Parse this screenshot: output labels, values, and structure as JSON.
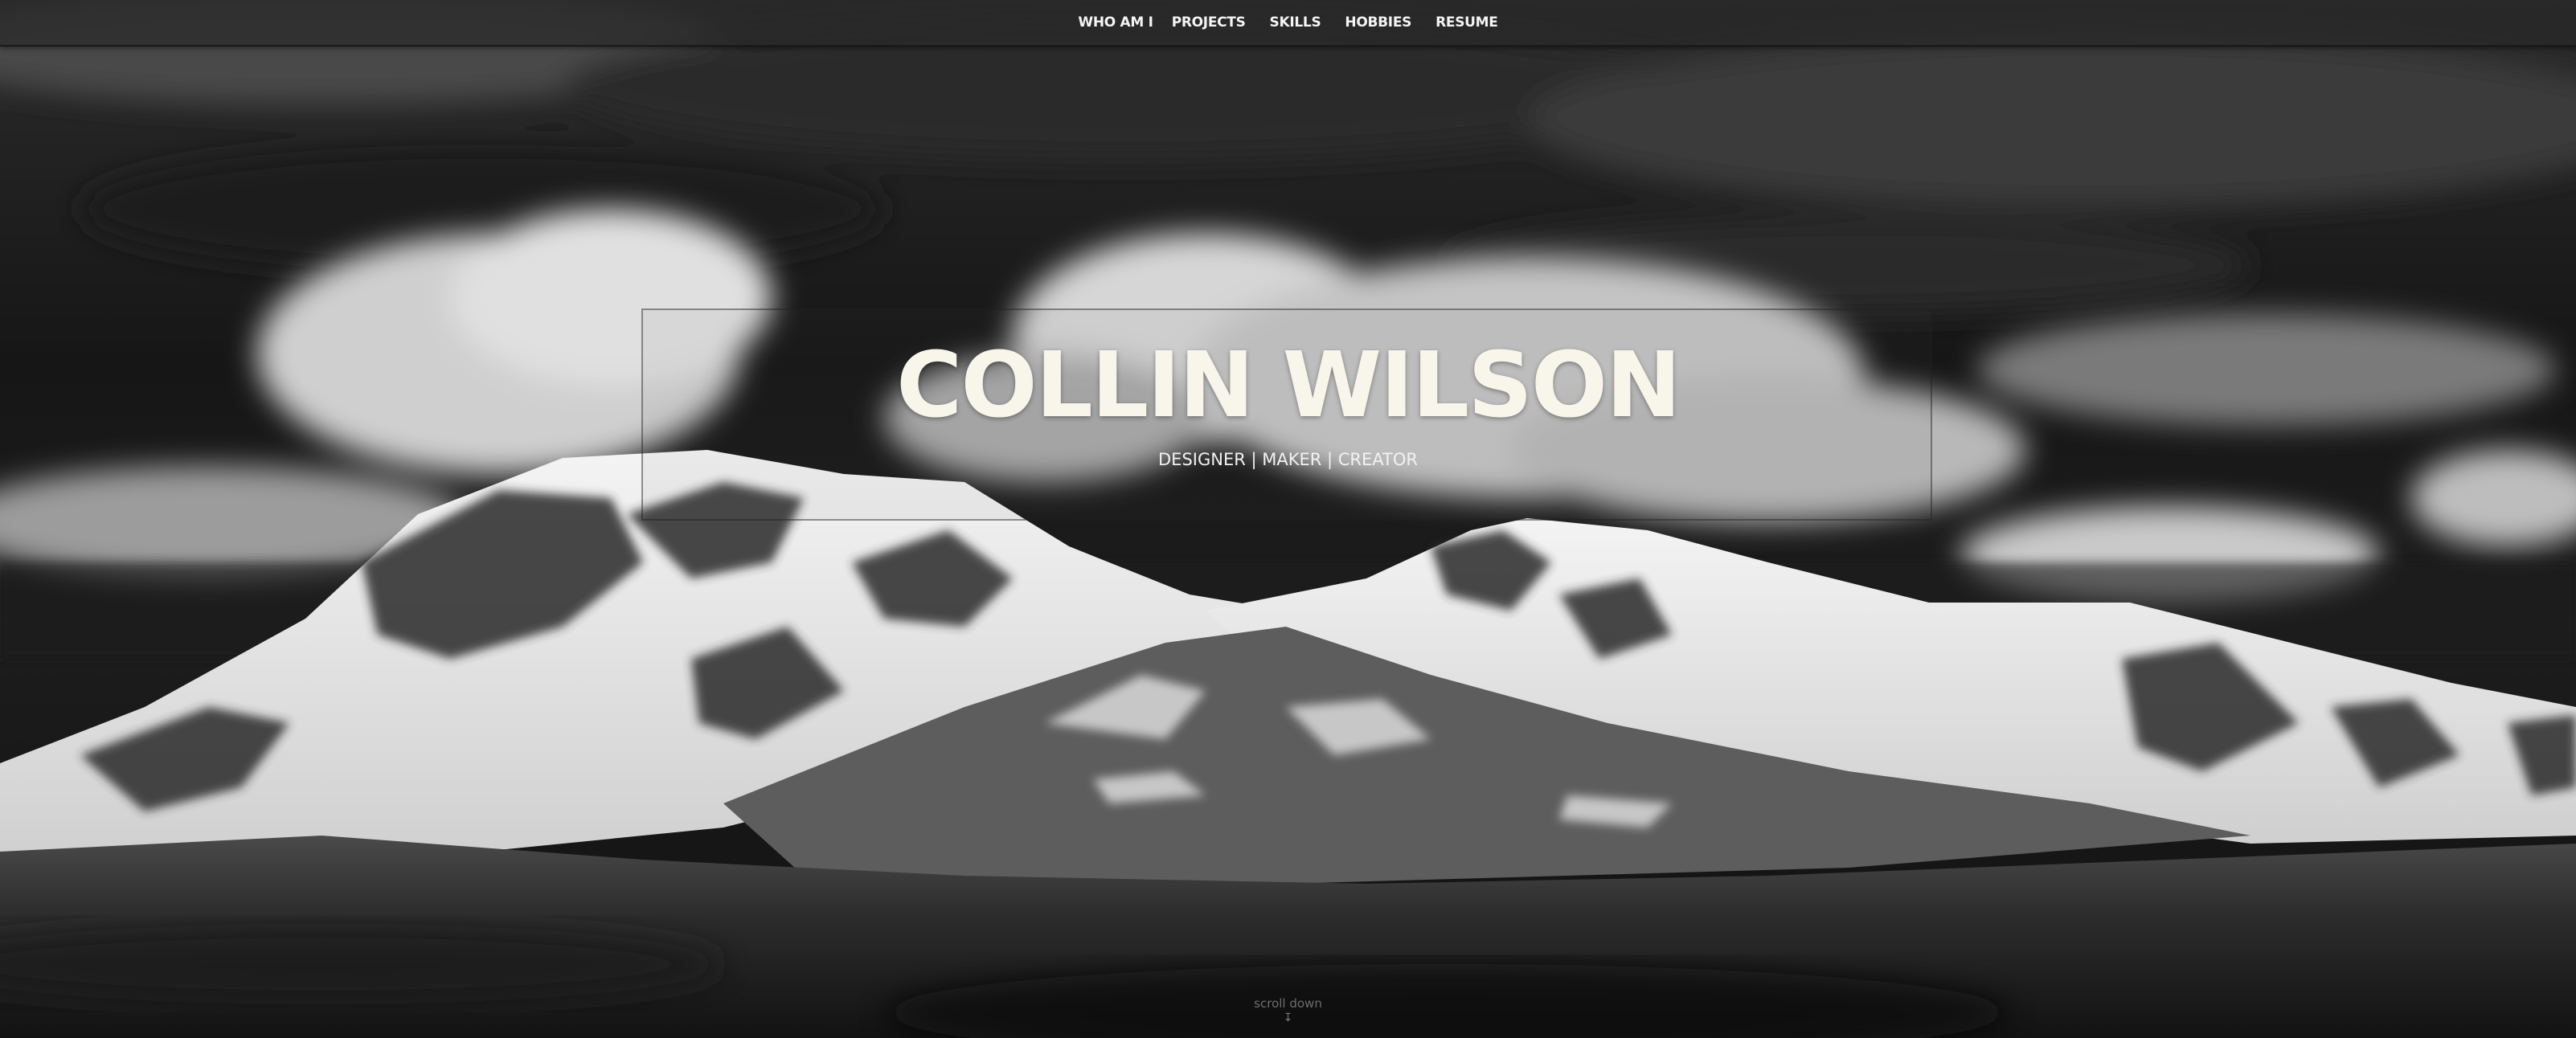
{
  "nav": {
    "items": [
      {
        "label": "WHO AM I"
      },
      {
        "label": "PROJECTS"
      },
      {
        "label": "SKILLS"
      },
      {
        "label": "HOBBIES"
      },
      {
        "label": "RESUME"
      }
    ]
  },
  "hero": {
    "name": "COLLIN WILSON",
    "tagline": "DESIGNER | MAKER | CREATOR",
    "background": "black-and-white-snowy-mountain-photo"
  },
  "scroll": {
    "label": "scroll down",
    "icon": "double-chevron-down-icon"
  }
}
